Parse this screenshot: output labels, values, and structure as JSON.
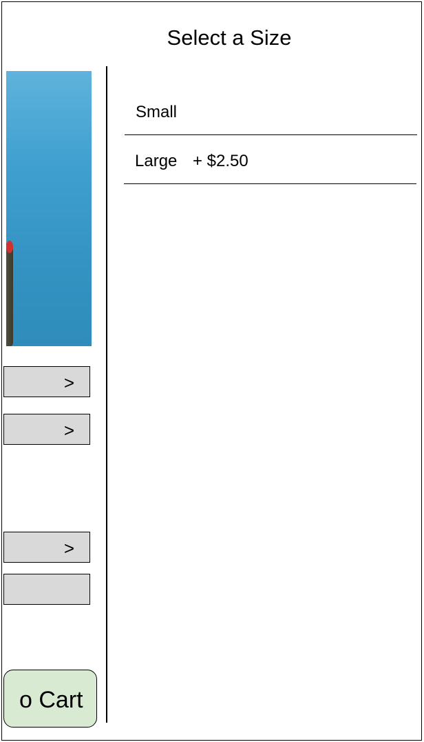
{
  "dialog": {
    "title": "Select a Size"
  },
  "sizes": [
    {
      "label": "Small",
      "price": ""
    },
    {
      "label": "Large",
      "price": "+ $2.50"
    }
  ],
  "background": {
    "option_rows": [
      {
        "chevron": ">"
      },
      {
        "chevron": ">"
      },
      {
        "chevron": ">"
      },
      {
        "chevron": ""
      }
    ],
    "cart_button_label": "o Cart"
  },
  "colors": {
    "option_row_bg": "#d9d9d9",
    "cart_button_bg": "#d9ead3",
    "photo_blue": "#3f9fcf"
  }
}
